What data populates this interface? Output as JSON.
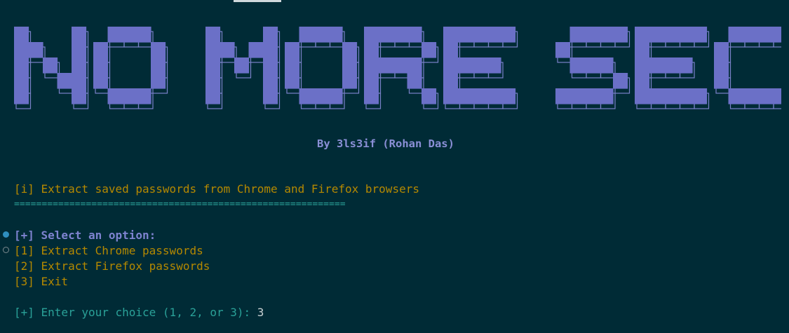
{
  "banner": {
    "title": "NO MORE SECRETS",
    "fill_color": "#6b70c7",
    "outline_color": "#7a81c9"
  },
  "author": "By 3ls3if (Rohan Das)",
  "info_line": "[i] Extract saved passwords from Chrome and Firefox browsers",
  "separator": "============================================================",
  "menu": {
    "prompt": "[+] Select an option:",
    "options": [
      "[1] Extract Chrome passwords",
      "[2] Extract Firefox passwords",
      "[3] Exit"
    ]
  },
  "input": {
    "prompt": "[+] Enter your choice (1, 2, or 3):",
    "value": "3"
  },
  "colors": {
    "background": "#002b36",
    "yellow": "#b58900",
    "cyan": "#2aa198",
    "accent": "#7e83d0"
  }
}
